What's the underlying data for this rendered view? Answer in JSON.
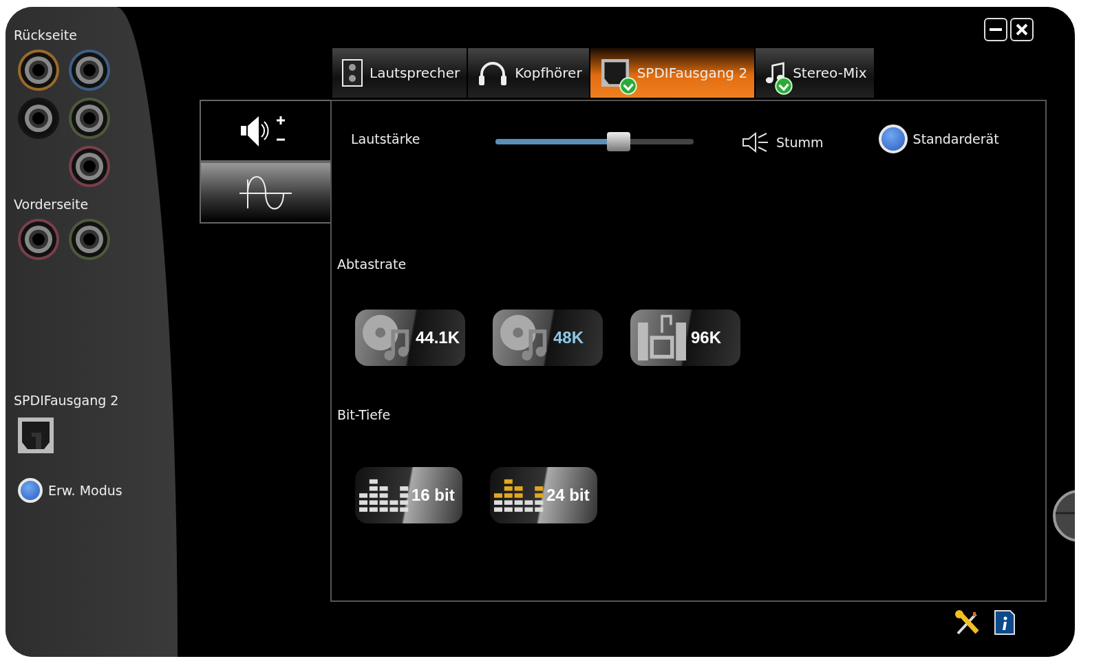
{
  "left_panel": {
    "rear_title": "Rückseite",
    "rear_rows": [
      {
        "jacks": [
          {
            "color": "#9a6a2a"
          },
          {
            "color": "#3e5f86"
          }
        ]
      },
      {
        "jacks": [
          {
            "color": "#151515"
          },
          {
            "color": "#4e5a3a"
          }
        ]
      },
      {
        "jacks": [
          {
            "color": "#7a3f4c"
          }
        ]
      }
    ],
    "front_title": "Vorderseite",
    "front_jacks": [
      {
        "color": "#7a3f4c"
      },
      {
        "color": "#4e5a3a"
      }
    ],
    "device_title": "SPDIFausgang 2",
    "advanced_mode": "Erw. Modus"
  },
  "tabs": [
    {
      "label": "Lautsprecher",
      "kind": "speaker",
      "selected": false,
      "connected": false
    },
    {
      "label": "Kopfhörer",
      "kind": "headphones",
      "selected": false,
      "connected": false
    },
    {
      "label": "SPDIFausgang 2",
      "kind": "spdif",
      "selected": true,
      "connected": true
    },
    {
      "label": "Stereo-Mix",
      "kind": "note",
      "selected": false,
      "connected": true
    }
  ],
  "side_tabs": [
    {
      "kind": "volume",
      "selected": true
    },
    {
      "kind": "wave",
      "selected": false
    }
  ],
  "volume": {
    "label": "Lautstärke",
    "level": 0.62,
    "mute": "Stumm",
    "default_device": "Standarderät"
  },
  "sample_rate": {
    "title": "Abtastrate",
    "options": [
      {
        "label": "44.1K",
        "kind": "disc",
        "selected": false
      },
      {
        "label": "48K",
        "kind": "disc",
        "selected": true
      },
      {
        "label": "96K",
        "kind": "system",
        "selected": false
      }
    ]
  },
  "bit_depth": {
    "title": "Bit-Tiefe",
    "options": [
      {
        "label": "16 bit",
        "selected": false
      },
      {
        "label": "24 bit",
        "selected": true
      }
    ]
  }
}
